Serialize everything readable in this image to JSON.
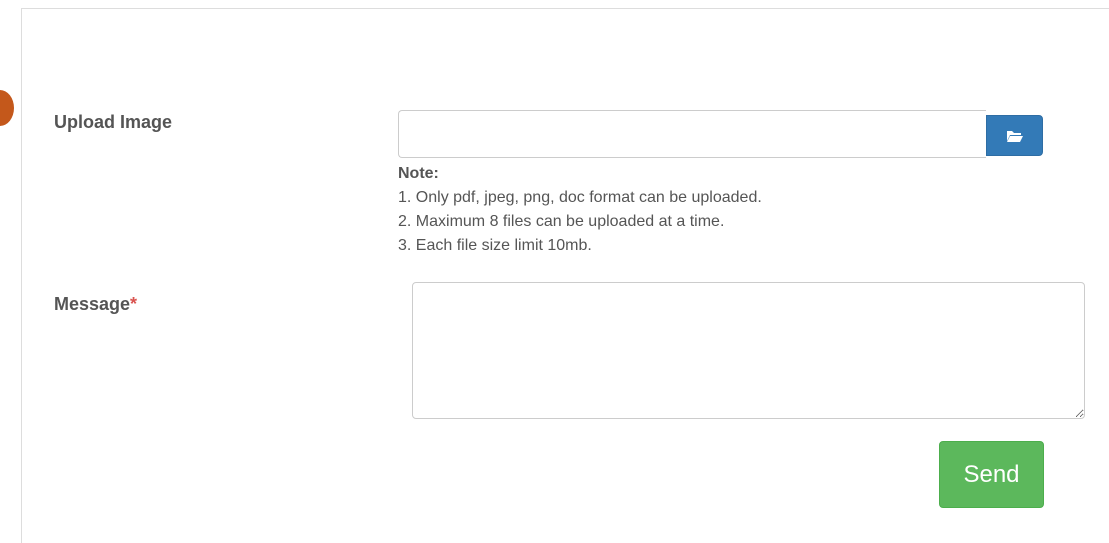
{
  "upload": {
    "label": "Upload Image",
    "value": "",
    "placeholder": "",
    "browse_icon": "folder-open-icon"
  },
  "note": {
    "title": "Note:",
    "lines": [
      "1. Only pdf, jpeg, png, doc format can be uploaded.",
      "2. Maximum 8 files can be uploaded at a time.",
      "3. Each file size limit 10mb."
    ]
  },
  "message": {
    "label": "Message",
    "required_mark": "*",
    "value": ""
  },
  "send_button": {
    "label": "Send"
  },
  "colors": {
    "primary": "#337ab7",
    "success": "#5cb85c",
    "required": "#d9534f",
    "marker": "#c4581b"
  }
}
